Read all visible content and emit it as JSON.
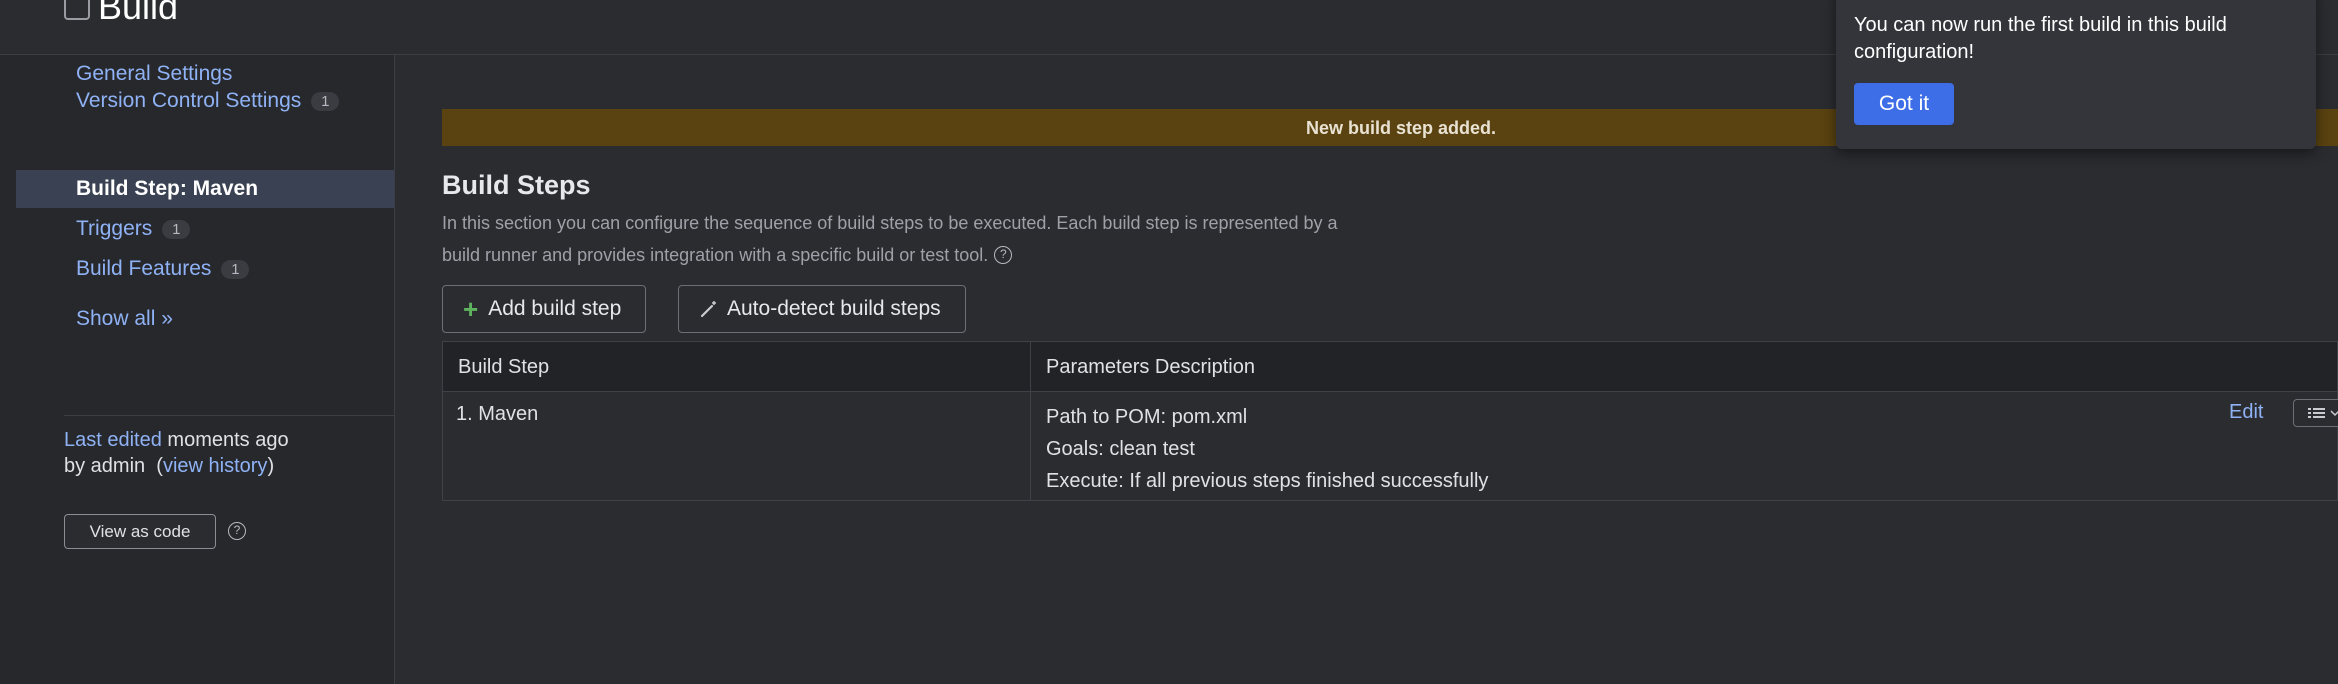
{
  "header": {
    "title": "Build"
  },
  "sidebar": {
    "items": [
      {
        "label": "General Settings",
        "badge": ""
      },
      {
        "label": "Version Control Settings",
        "badge": "1"
      },
      {
        "label": "Build Step: Maven",
        "badge": ""
      },
      {
        "label": "Triggers",
        "badge": "1"
      },
      {
        "label": "Build Features",
        "badge": "1"
      }
    ],
    "show_all": "Show all »",
    "last_edited_link": "Last edited",
    "last_edited_time": " moments ago",
    "by_user": "by admin",
    "view_history_open": "(",
    "view_history": "view history",
    "view_history_close": ")",
    "view_as_code": "View as code",
    "help_glyph": "?"
  },
  "banner": {
    "message": "New build step added."
  },
  "main": {
    "section_title": "Build Steps",
    "description_line1": "In this section you can configure the sequence of build steps to be executed. Each build step is represented by a",
    "description_line2": "build runner and provides integration with a specific build or test tool.",
    "help_glyph": "?",
    "add_step": "Add build step",
    "add_step_icon": "+",
    "auto_detect": "Auto-detect build steps"
  },
  "table": {
    "headers": [
      "Build Step",
      "Parameters Description"
    ],
    "rows": [
      {
        "step": "1. Maven",
        "params": [
          "Path to POM: pom.xml",
          "Goals: clean test",
          "Execute: If all previous steps finished successfully"
        ],
        "edit": "Edit"
      }
    ]
  },
  "popover": {
    "text": "You can now run the first build in this build configuration!",
    "button": "Got it"
  },
  "colors": {
    "background": "#2b2c30",
    "link": "#8fb2f5",
    "banner": "#5a4310",
    "primary_button": "#3d6ee8",
    "active_item": "#3a4152"
  },
  "icons": [
    "checkbox-icon",
    "plus-icon",
    "magic-wand-icon",
    "help-icon",
    "list-menu-icon",
    "chevron-down-icon"
  ]
}
